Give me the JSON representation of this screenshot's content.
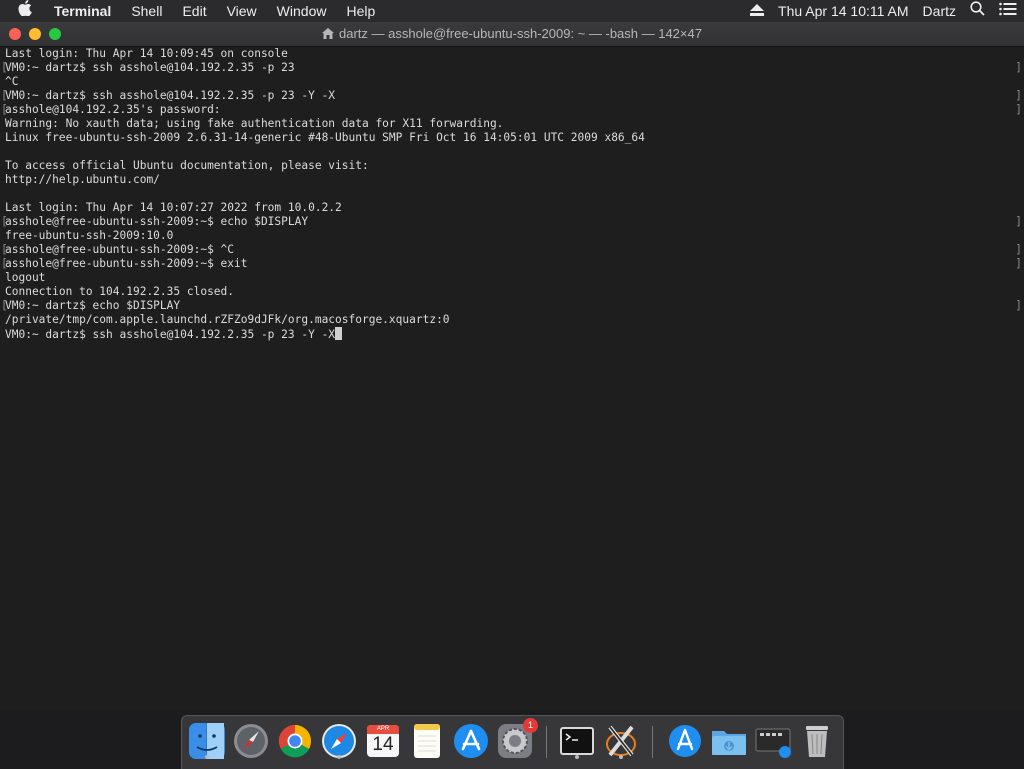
{
  "menubar": {
    "app_name": "Terminal",
    "menus": [
      "Shell",
      "Edit",
      "View",
      "Window",
      "Help"
    ],
    "datetime": "Thu Apr 14  10:11 AM",
    "user": "Dartz"
  },
  "window": {
    "title": "dartz — asshole@free-ubuntu-ssh-2009: ~ — -bash — 142×47"
  },
  "terminal": {
    "lines": [
      "Last login: Thu Apr 14 10:09:45 on console",
      "VM0:~ dartz$ ssh asshole@104.192.2.35 -p 23",
      "^C",
      "VM0:~ dartz$ ssh asshole@104.192.2.35 -p 23 -Y -X",
      "asshole@104.192.2.35's password:",
      "Warning: No xauth data; using fake authentication data for X11 forwarding.",
      "Linux free-ubuntu-ssh-2009 2.6.31-14-generic #48-Ubuntu SMP Fri Oct 16 14:05:01 UTC 2009 x86_64",
      "",
      "To access official Ubuntu documentation, please visit:",
      "http://help.ubuntu.com/",
      "",
      "Last login: Thu Apr 14 10:07:27 2022 from 10.0.2.2",
      "asshole@free-ubuntu-ssh-2009:~$ echo $DISPLAY",
      "free-ubuntu-ssh-2009:10.0",
      "asshole@free-ubuntu-ssh-2009:~$ ^C",
      "asshole@free-ubuntu-ssh-2009:~$ exit",
      "logout",
      "Connection to 104.192.2.35 closed.",
      "VM0:~ dartz$ echo $DISPLAY",
      "/private/tmp/com.apple.launchd.rZFZo9dJFk/org.macosforge.xquartz:0",
      "VM0:~ dartz$ ssh asshole@104.192.2.35 -p 23 -Y -X"
    ]
  },
  "dock": {
    "calendar_month": "APR",
    "calendar_day": "14",
    "settings_badge": "1"
  },
  "colors": {
    "terminal_bg": "#1e1e1e",
    "terminal_fg": "#dcdcdc",
    "close": "#fe5f57",
    "minimize": "#febc2e",
    "zoom": "#28c840"
  }
}
